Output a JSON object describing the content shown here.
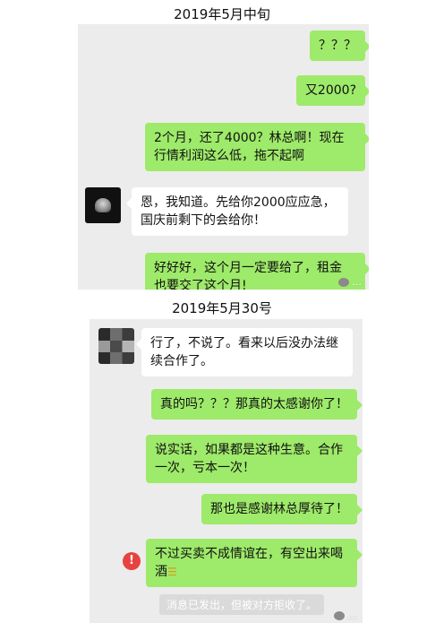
{
  "captions": {
    "top": "2019年5月中旬",
    "bottom": "2019年5月30号"
  },
  "panel1": {
    "messages": [
      {
        "sender": "me",
        "text": "？？？"
      },
      {
        "sender": "me",
        "text": "又2000?"
      },
      {
        "sender": "me",
        "lines": [
          "2个月，还了4000？林总啊！现在",
          "行情利润这么低，拖不起啊"
        ]
      },
      {
        "sender": "them",
        "lines": [
          "恩，我知道。先给你2000应应急，",
          "国庆前剩下的会给你！"
        ]
      },
      {
        "sender": "me",
        "lines": [
          "好好好，这个月一定要给了，租金",
          "也要交了这个月!"
        ]
      }
    ],
    "watermark": "…"
  },
  "panel2": {
    "messages": [
      {
        "sender": "them",
        "lines": [
          "行了，不说了。看来以后没办法继",
          "续合作了。"
        ]
      },
      {
        "sender": "me",
        "text": "真的吗？？？那真的太感谢你了！"
      },
      {
        "sender": "me",
        "lines": [
          "说实话，如果都是这种生意。合作",
          "一次，亏本一次！"
        ]
      },
      {
        "sender": "me",
        "text": "那也是感谢林总厚待了！"
      },
      {
        "sender": "me",
        "lines": [
          "不过买卖不成情谊在，有空出来喝",
          "酒"
        ],
        "emoji": "beer-icon",
        "failed": true,
        "failed_glyph": "!"
      }
    ],
    "system_message": "消息已发出，但被对方拒收了。",
    "watermark": "…"
  },
  "colors": {
    "bubble_me": "#9eea6a",
    "bubble_them": "#ffffff",
    "chat_bg": "#ececec",
    "error": "#e64340"
  }
}
